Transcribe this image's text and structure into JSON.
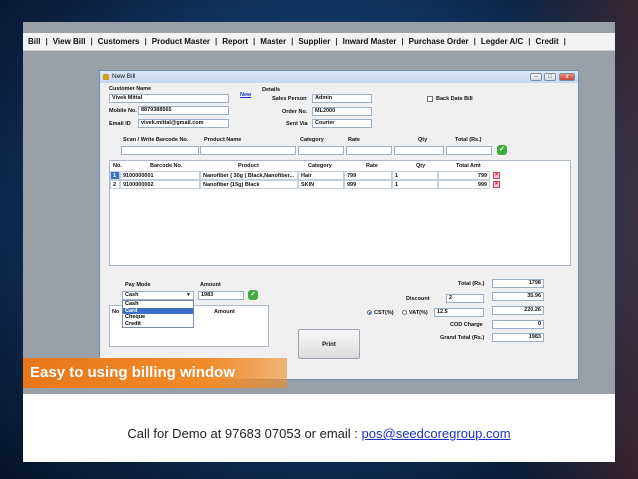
{
  "menu": [
    "Bill",
    "View Bill",
    "Customers",
    "Product Master",
    "Report",
    "Master",
    "Supplier",
    "Inward Master",
    "Purchase Order",
    "Legder A/C",
    "Credit"
  ],
  "window": {
    "title": "New Bill",
    "minimize": "–",
    "maximize": "□",
    "close": "x"
  },
  "customer": {
    "name_label": "Customer Name",
    "name_value": "Vivek  Mittal",
    "new_link": "New",
    "mobile_label": "Mobile No.",
    "mobile_value": "8879388565",
    "email_label": "Email ID",
    "email_value": "vivek.mittal@gmail.com"
  },
  "details": {
    "heading": "Details",
    "sales_person_label": "Sales Person",
    "sales_person_value": "Admin",
    "order_no_label": "Order No.",
    "order_no_value": "ML2000",
    "sent_via_label": "Sent Via",
    "sent_via_value": "Courier",
    "back_date_label": "Back Date Bill"
  },
  "entry_headers": {
    "barcode": "Scan / Write Barcode No.",
    "product": "Product Name",
    "category": "Category",
    "rate": "Rate",
    "qty": "Qty",
    "total": "Total (Rs.)"
  },
  "items_headers": {
    "no": "No.",
    "barcode": "Barcode No.",
    "product": "Product",
    "category": "Category",
    "rate": "Rate",
    "qty": "Qty",
    "total": "Total Amt"
  },
  "items": [
    {
      "no": "1",
      "barcode": "9100000001",
      "product": "Nanofiber ( 30g ) Black,Nanofiber...",
      "category": "Hair",
      "rate": "799",
      "qty": "1",
      "total": "799"
    },
    {
      "no": "2",
      "barcode": "9100000002",
      "product": "Nanofiber (15g) Black",
      "category": "SKIN",
      "rate": "999",
      "qty": "1",
      "total": "999"
    }
  ],
  "payment": {
    "mode_label": "Pay Mode",
    "amount_label": "Amount",
    "mode_value": "Cash",
    "amount_value": "1983",
    "options": [
      "Cash",
      "Card",
      "Cheque",
      "Credit"
    ],
    "highlighted_option": "Card",
    "table_no": "No",
    "table_amount": "Amount"
  },
  "totals": {
    "total_label": "Total (Rs.)",
    "total_value": "1798",
    "discount_label": "Discount",
    "discount_pct": "2",
    "discount_value": "35.96",
    "cst_label": "CST(%)",
    "vat_label": "VAT(%)",
    "vat_pct": "12.5",
    "tax_value": "220.26",
    "cod_label": "COD Charge",
    "cod_value": "0",
    "grand_label": "Grand Total (Rs.)",
    "grand_value": "1983"
  },
  "print_label": "Print",
  "caption": "Easy to using billing window",
  "footer": {
    "text": "Call for Demo at 97683 07053 or email : ",
    "email": "pos@seedcoregroup.com"
  }
}
